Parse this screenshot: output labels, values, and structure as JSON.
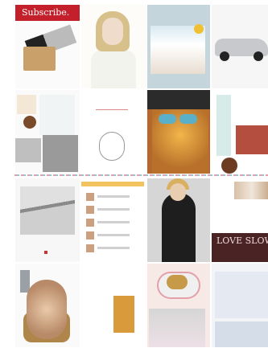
{
  "tiles": {
    "subscribe": {
      "banner": "Subscribe."
    },
    "home_magazine": {
      "masthead": ""
    },
    "jewelry_page": {
      "brand": ""
    },
    "magazine_cover": {
      "title": ""
    },
    "love_slow": {
      "text": "LOVE SLOW"
    }
  },
  "colors": {
    "subscribe_red": "#c4202b",
    "background": "#ffffff",
    "divider_pink": "#e0a0a0",
    "divider_blue": "#9fc0d8"
  },
  "icons": []
}
